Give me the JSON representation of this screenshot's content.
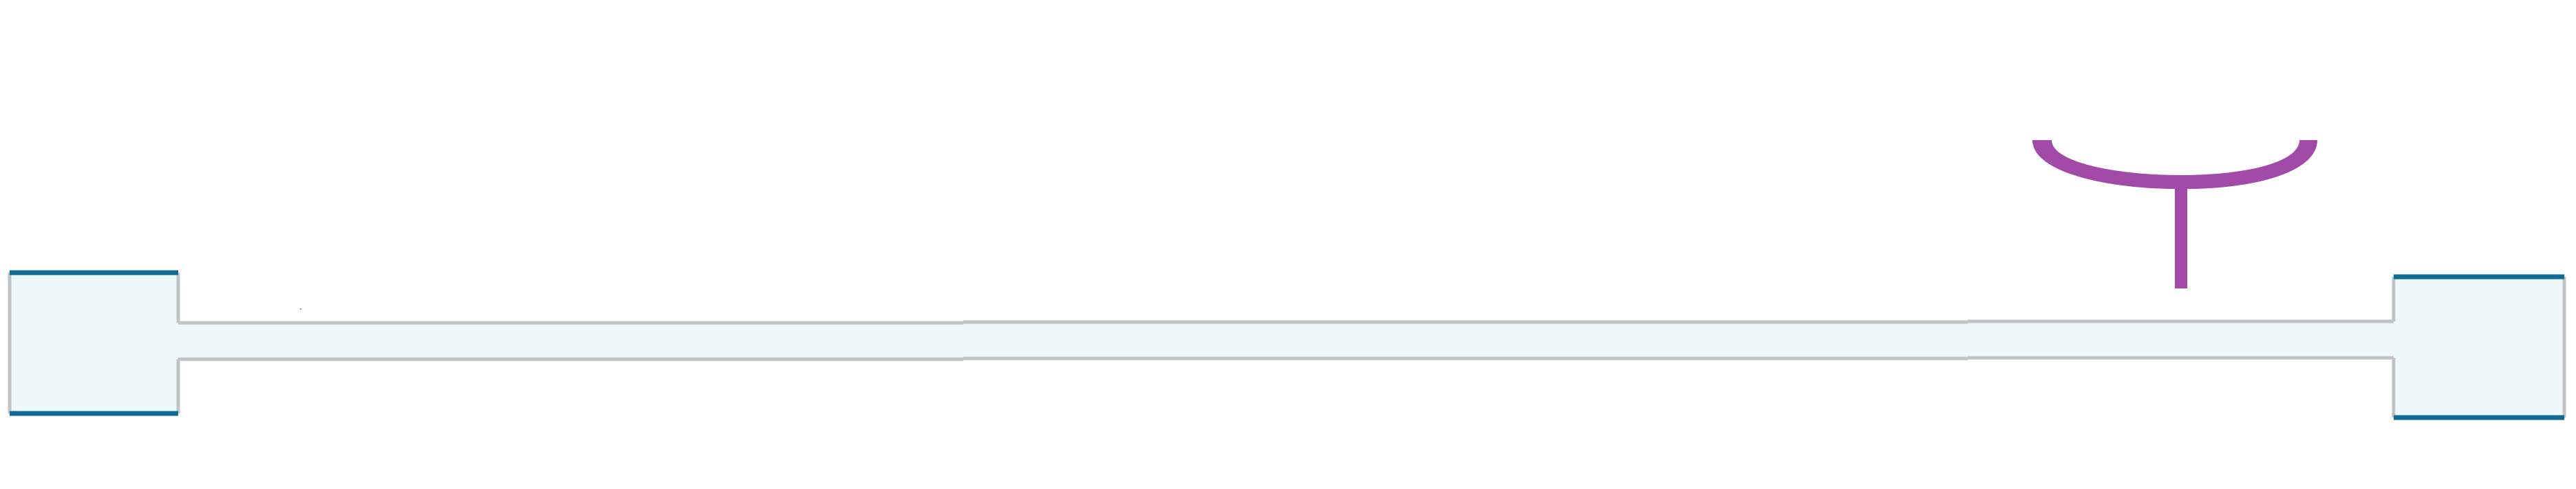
{
  "diagram": {
    "colors": {
      "background": "#ffffff",
      "fill": "#eef8fb",
      "outline": "#c0c4c7",
      "end_cap": "#0f6b95",
      "probe": "#a24aa8"
    },
    "icons": {
      "left_end": "end-block-icon",
      "right_end": "end-block-icon",
      "probe": "probe-cup-icon"
    }
  }
}
